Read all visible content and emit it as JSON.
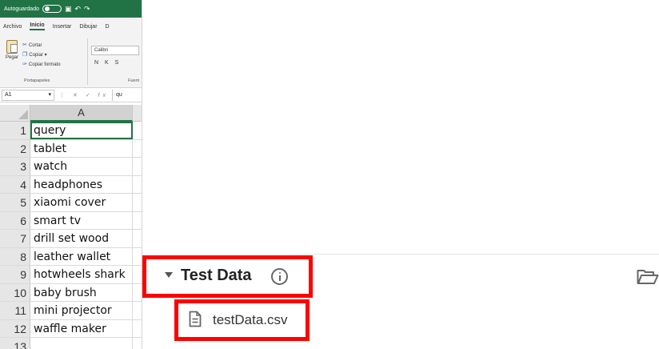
{
  "excel": {
    "titlebar": {
      "autosave_label": "Autoguardado"
    },
    "tabs": [
      "Archivo",
      "Inicio",
      "Insertar",
      "Dibujar",
      "D"
    ],
    "ribbon": {
      "paste_label": "Pegar",
      "cut_label": "Cortar",
      "copy_label": "Copiar",
      "format_painter_label": "Copiar formato",
      "font_name": "Calibri",
      "format_buttons": "N K S",
      "clipboard_group_label": "Portapapeles",
      "font_group_label": "Fuent"
    },
    "formula_bar": {
      "name_box": "A1",
      "value": "qu"
    },
    "column_header": "A",
    "rows": [
      {
        "num": "1",
        "value": "query"
      },
      {
        "num": "2",
        "value": "tablet"
      },
      {
        "num": "3",
        "value": "watch"
      },
      {
        "num": "4",
        "value": "headphones"
      },
      {
        "num": "5",
        "value": "xiaomi cover"
      },
      {
        "num": "6",
        "value": "smart tv"
      },
      {
        "num": "7",
        "value": "drill set wood"
      },
      {
        "num": "8",
        "value": "leather wallet"
      },
      {
        "num": "9",
        "value": "hotwheels shark"
      },
      {
        "num": "10",
        "value": "baby brush"
      },
      {
        "num": "11",
        "value": "mini projector"
      },
      {
        "num": "12",
        "value": "waffle maker"
      },
      {
        "num": "13",
        "value": ""
      }
    ],
    "accent_color": "#217346"
  },
  "panel": {
    "section_title": "Test Data",
    "file_name": "testData.csv",
    "highlight_color": "#ff0000",
    "icons": [
      "caret-down-icon",
      "info-icon",
      "folder-open-icon",
      "file-text-icon"
    ]
  }
}
